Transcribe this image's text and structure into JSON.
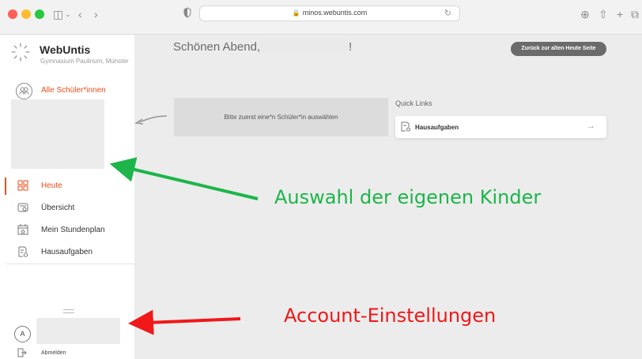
{
  "browser": {
    "url": "minos.webuntis.com"
  },
  "sidebar": {
    "brand": "WebUntis",
    "school": "Gymnasium Paulinum, Münster",
    "students_label": "Alle Schüler*innen",
    "nav": [
      {
        "label": "Heute",
        "icon": "today-grid-icon",
        "active": true
      },
      {
        "label": "Übersicht",
        "icon": "overview-icon",
        "active": false
      },
      {
        "label": "Mein Stundenplan",
        "icon": "calendar-icon",
        "active": false
      },
      {
        "label": "Hausaufgaben",
        "icon": "homework-icon",
        "active": false
      }
    ],
    "account_initial": "A",
    "logout_label": "Abmelden"
  },
  "main": {
    "greeting": "Schönen Abend,",
    "greeting_end": "!",
    "back_button": "Zurück zur alten Heute Seite",
    "select_prompt": "Bitte zuerst eine*n Schüler*in auswählen",
    "quick_links_title": "Quick Links",
    "quick_links": [
      {
        "label": "Hausaufgaben",
        "icon": "homework-icon",
        "arrow": "→"
      }
    ]
  },
  "annotations": {
    "children": "Auswahl der eigenen Kinder",
    "account": "Account-Einstellungen"
  },
  "colors": {
    "accent": "#e94e1b",
    "annotation_green": "#1db54a",
    "annotation_red": "#f01818"
  }
}
